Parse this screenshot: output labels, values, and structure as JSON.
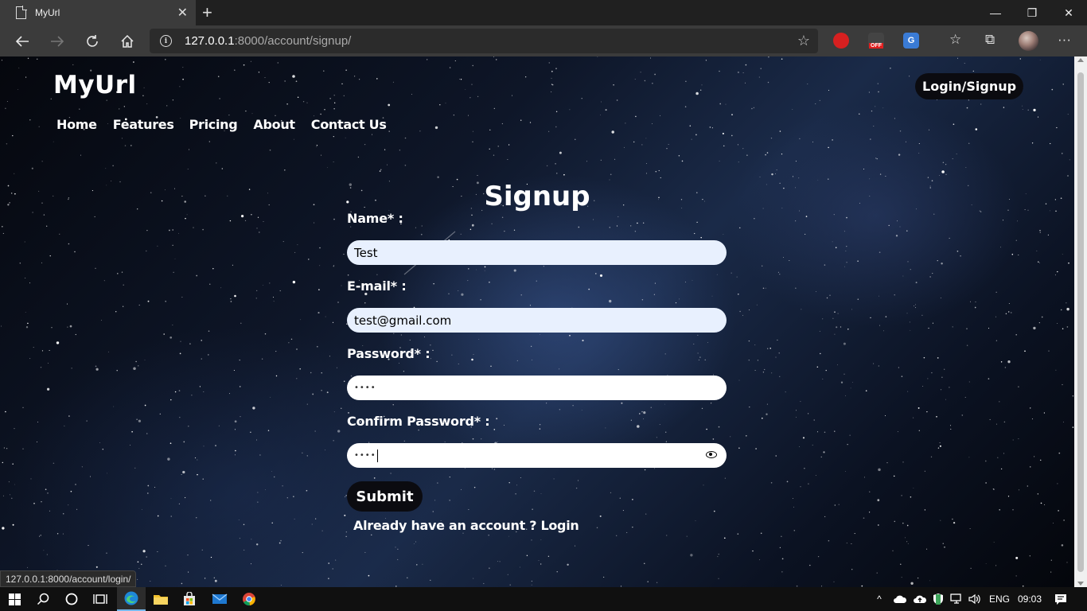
{
  "browser": {
    "tab_title": "MyUrl",
    "tab_close": "✕",
    "new_tab": "+",
    "window": {
      "minimize": "—",
      "restore": "❐",
      "close": "✕"
    },
    "url_host": "127.0.0.1",
    "url_path": ":8000/account/signup/",
    "status_url": "127.0.0.1:8000/account/login/",
    "extensions": {
      "off_badge": "OFF",
      "translate": "G"
    }
  },
  "site": {
    "logo": "MyUrl",
    "login_signup": "Login/Signup",
    "nav": [
      "Home",
      "Features",
      "Pricing",
      "About",
      "Contact Us"
    ]
  },
  "form": {
    "title": "Signup",
    "name_label": "Name* :",
    "name_value": "Test",
    "email_label": "E-mail* :",
    "email_value": "test@gmail.com",
    "password_label": "Password* :",
    "password_value": "••••",
    "confirm_label": "Confirm Password* :",
    "confirm_value": "••••",
    "submit": "Submit",
    "already_text": "Already have an account ? ",
    "login_link": "Login"
  },
  "taskbar": {
    "language": "ENG",
    "time": "09:03"
  },
  "theme": {
    "chrome_bg": "#3b3b3b",
    "autofill_bg": "#e8f0fe",
    "button_bg": "#0b0b10"
  }
}
